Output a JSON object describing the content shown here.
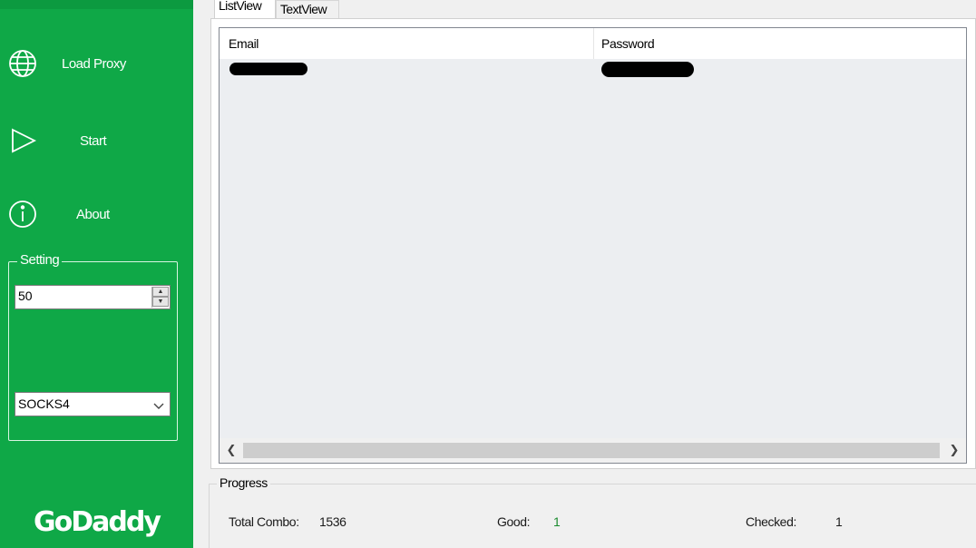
{
  "sidebar": {
    "background": "#0fa847",
    "nav": {
      "load_proxy": {
        "label": "Load Proxy",
        "icon": "globe-icon"
      },
      "start": {
        "label": "Start",
        "icon": "play-icon"
      },
      "about": {
        "label": "About",
        "icon": "info-icon"
      }
    },
    "setting": {
      "legend": "Setting",
      "threads_value": "50",
      "proxy_type": "SOCKS4"
    },
    "logo_text": "GoDaddy"
  },
  "tabs": [
    {
      "label": "ListView",
      "active": true
    },
    {
      "label": "TextView",
      "active": false
    }
  ],
  "listview": {
    "columns": [
      "Email",
      "Password"
    ],
    "rows": [
      {
        "email": "[redacted]",
        "password": "[redacted]"
      }
    ]
  },
  "progress": {
    "legend": "Progress",
    "total_combo_label": "Total Combo:",
    "total_combo_value": "1536",
    "good_label": "Good:",
    "good_value": "1",
    "good_color": "#1a8a2e",
    "checked_label": "Checked:",
    "checked_value": "1"
  }
}
